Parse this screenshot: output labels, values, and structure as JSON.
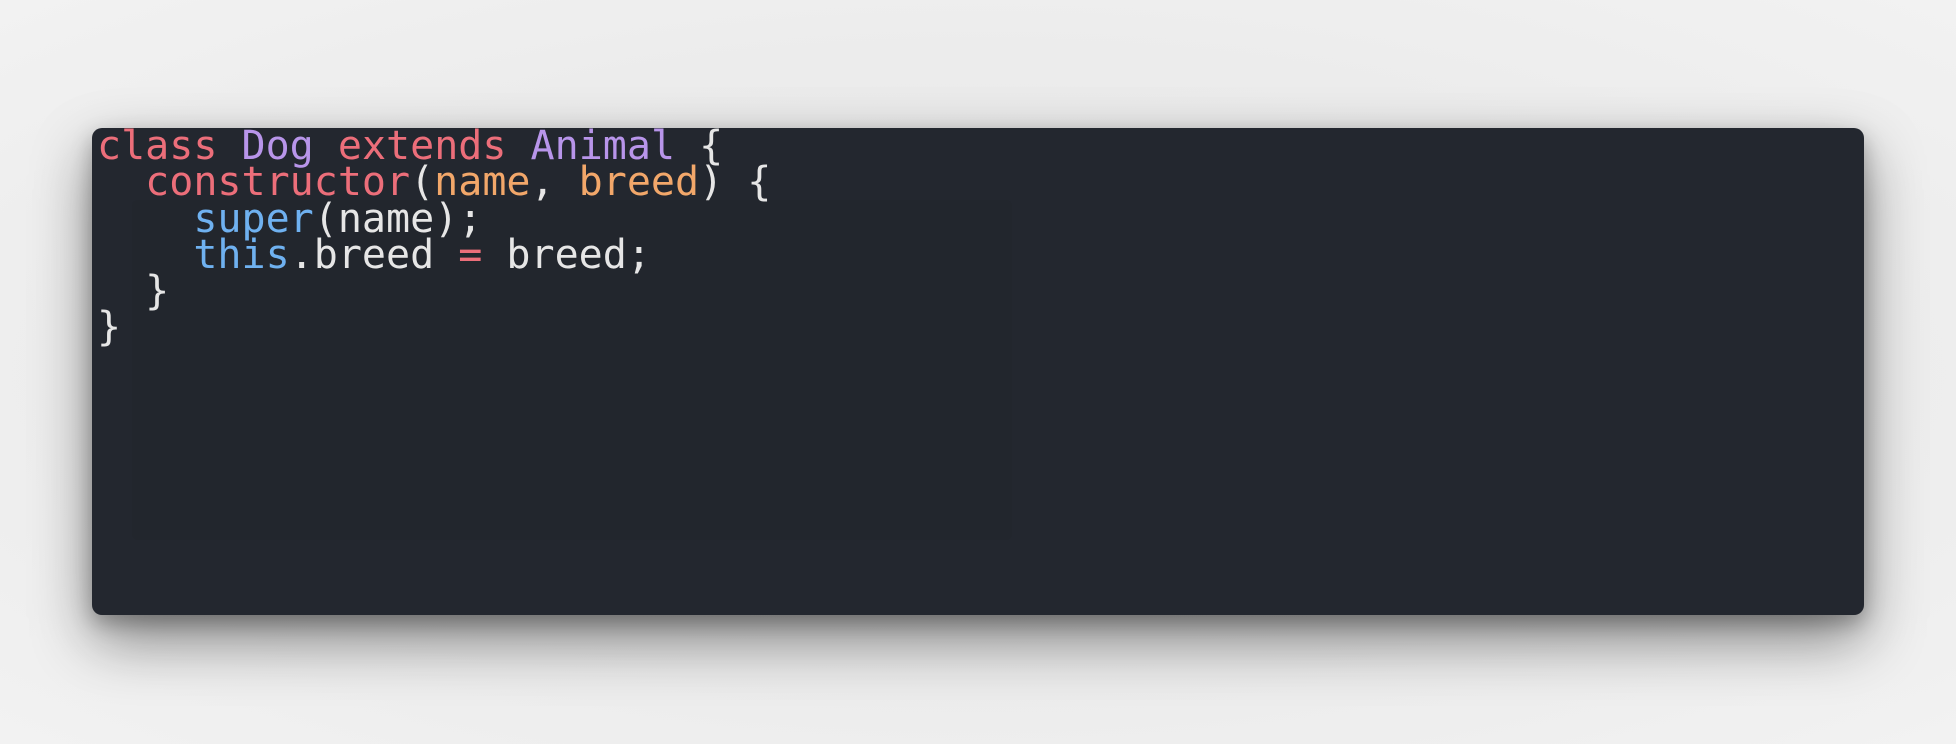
{
  "colors": {
    "background": "#ececec",
    "editor_background": "#23272f",
    "keyword": "#ec6e7a",
    "class_name": "#b895ea",
    "parameter": "#f2a76a",
    "builtin": "#6fb1f0",
    "text": "#e6e6e6"
  },
  "code": {
    "language": "javascript",
    "lines": [
      {
        "tokens": [
          {
            "type": "keyword",
            "text": "class"
          },
          {
            "type": "plain",
            "text": " "
          },
          {
            "type": "class",
            "text": "Dog"
          },
          {
            "type": "plain",
            "text": " "
          },
          {
            "type": "keyword",
            "text": "extends"
          },
          {
            "type": "plain",
            "text": " "
          },
          {
            "type": "class",
            "text": "Animal"
          },
          {
            "type": "plain",
            "text": " "
          },
          {
            "type": "punct",
            "text": "{"
          }
        ]
      },
      {
        "tokens": [
          {
            "type": "plain",
            "text": "  "
          },
          {
            "type": "func",
            "text": "constructor"
          },
          {
            "type": "punct",
            "text": "("
          },
          {
            "type": "param",
            "text": "name"
          },
          {
            "type": "punct",
            "text": ", "
          },
          {
            "type": "param",
            "text": "breed"
          },
          {
            "type": "punct",
            "text": ") {"
          }
        ]
      },
      {
        "tokens": [
          {
            "type": "plain",
            "text": "    "
          },
          {
            "type": "builtin",
            "text": "super"
          },
          {
            "type": "punct",
            "text": "(name);"
          }
        ]
      },
      {
        "tokens": [
          {
            "type": "plain",
            "text": "    "
          },
          {
            "type": "builtin",
            "text": "this"
          },
          {
            "type": "punct",
            "text": ".breed "
          },
          {
            "type": "op",
            "text": "="
          },
          {
            "type": "punct",
            "text": " breed;"
          }
        ]
      },
      {
        "tokens": [
          {
            "type": "plain",
            "text": "  "
          },
          {
            "type": "punct",
            "text": "}"
          }
        ]
      },
      {
        "tokens": [
          {
            "type": "punct",
            "text": "}"
          }
        ]
      }
    ]
  }
}
